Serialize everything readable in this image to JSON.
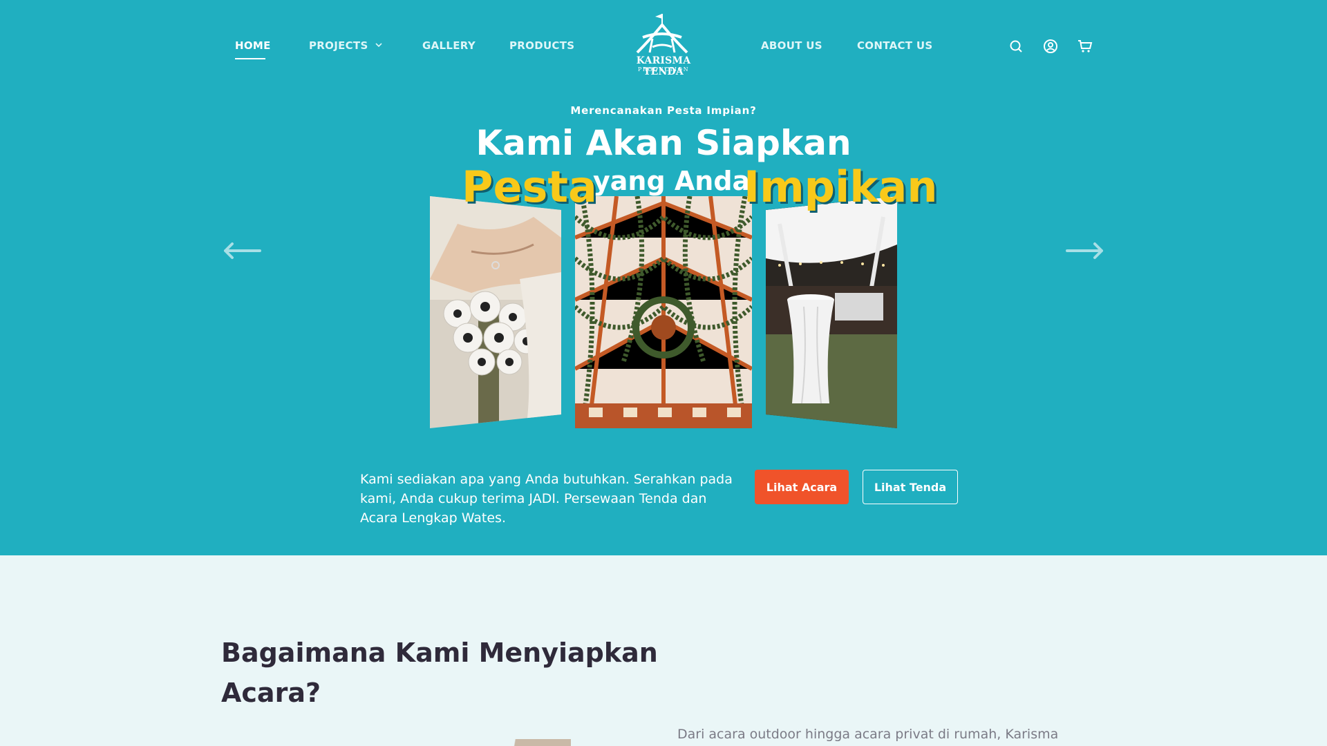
{
  "nav": {
    "home": "HOME",
    "projects": "PROJECTS",
    "gallery": "GALLERY",
    "products": "PRODUCTS",
    "about": "ABOUT US",
    "contact": "CONTACT US"
  },
  "logo": {
    "name": "KARISMA TENDA",
    "sub": "PRODUCTION"
  },
  "header_icons": [
    "search-icon",
    "user-icon",
    "cart-icon"
  ],
  "hero": {
    "eyebrow": "Merencanakan Pesta Impian?",
    "line1": "Kami Akan Siapkan",
    "word_pesta": "Pesta",
    "word_yang": "yang Anda",
    "word_impikan": "Impikan"
  },
  "carousel": {
    "slides": [
      "wedding-bouquet-photo",
      "tent-garland-ceiling-photo",
      "outdoor-cocktail-table-photo"
    ],
    "prev_icon": "arrow-left-icon",
    "next_icon": "arrow-right-icon"
  },
  "cta": {
    "tagline": "Kami sediakan apa yang Anda butuhkan. Serahkan pada kami, Anda cukup terima JADI. Persewaan Tenda dan Acara Lengkap Wates.",
    "primary": "Lihat Acara",
    "secondary": "Lihat Tenda"
  },
  "section": {
    "title": "Bagaimana Kami Menyiapkan Acara?",
    "text": "Dari acara outdoor hingga acara privat di rumah, Karisma"
  },
  "colors": {
    "hero_bg": "#20afc0",
    "accent_yellow": "#f8c91a",
    "cta_orange": "#f0532a",
    "page_bg": "#eaf6f7"
  }
}
